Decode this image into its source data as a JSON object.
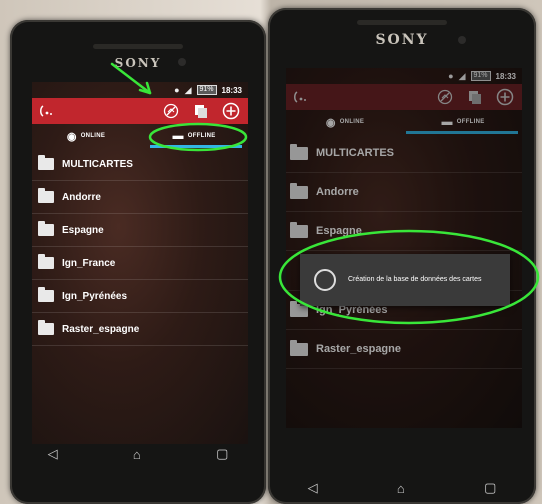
{
  "left_phone": {
    "brand": "SONY",
    "status": {
      "battery": "91%",
      "clock": "18:33"
    },
    "tabs": [
      {
        "label": "ONLINE",
        "icon": "globe-icon"
      },
      {
        "label": "OFFLINE",
        "icon": "sd-card-icon"
      }
    ],
    "selected_tab": "OFFLINE",
    "folders": [
      "MULTICARTES",
      "Andorre",
      "Espagne",
      "Ign_France",
      "Ign_Pyrénées",
      "Raster_espagne"
    ]
  },
  "right_phone": {
    "brand": "SONY",
    "status": {
      "battery": "91%",
      "clock": "18:33"
    },
    "tabs": [
      {
        "label": "ONLINE",
        "icon": "globe-icon"
      },
      {
        "label": "OFFLINE",
        "icon": "sd-card-icon"
      }
    ],
    "selected_tab": "OFFLINE",
    "folders": [
      "MULTICARTES",
      "Andorre",
      "Espagne",
      "Ign_Pyrénées",
      "Raster_espagne"
    ],
    "progress_dialog": {
      "message": "Création de la base de données des cartes"
    }
  },
  "colors": {
    "actionbar": "#c1262d",
    "tab_indicator": "#33b5e5",
    "annotation": "#39e639"
  }
}
